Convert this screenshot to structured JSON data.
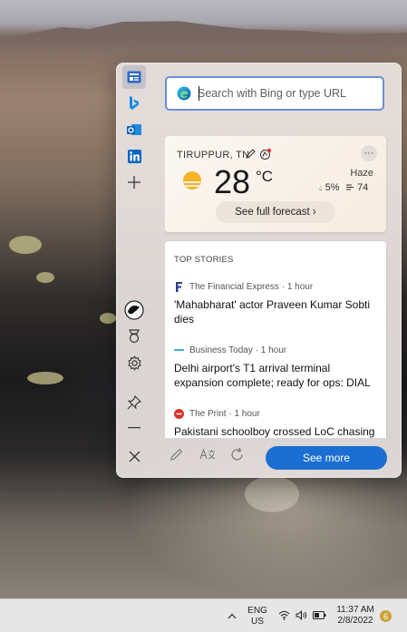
{
  "search": {
    "placeholder": "Search with Bing or type URL"
  },
  "weather": {
    "location": "TIRUPPUR, TN",
    "temperature": "28",
    "unit": "°C",
    "condition": "Haze",
    "precipitation": "5%",
    "aqi": "74",
    "forecast_button": "See full forecast ›"
  },
  "news": {
    "header": "TOP STORIES",
    "stories": [
      {
        "source": "The Financial Express · 1 hour",
        "title": "'Mahabharat' actor Praveen Kumar Sobti dies"
      },
      {
        "source": "Business Today · 1 hour",
        "title": "Delhi airport's T1 arrival terminal expansion complete; ready for ops: DIAL"
      },
      {
        "source": "The Print · 1 hour",
        "title": "Pakistani schoolboy crossed LoC chasing"
      }
    ]
  },
  "bottom_bar": {
    "see_more": "See more"
  },
  "taskbar": {
    "language_line1": "ENG",
    "language_line2": "US",
    "time": "11:37 AM",
    "date": "2/8/2022",
    "notification_count": "6"
  },
  "colors": {
    "accent": "#1c6fd2",
    "search_border": "#6b8fd6",
    "panel_bg": "#e8e2e0"
  }
}
